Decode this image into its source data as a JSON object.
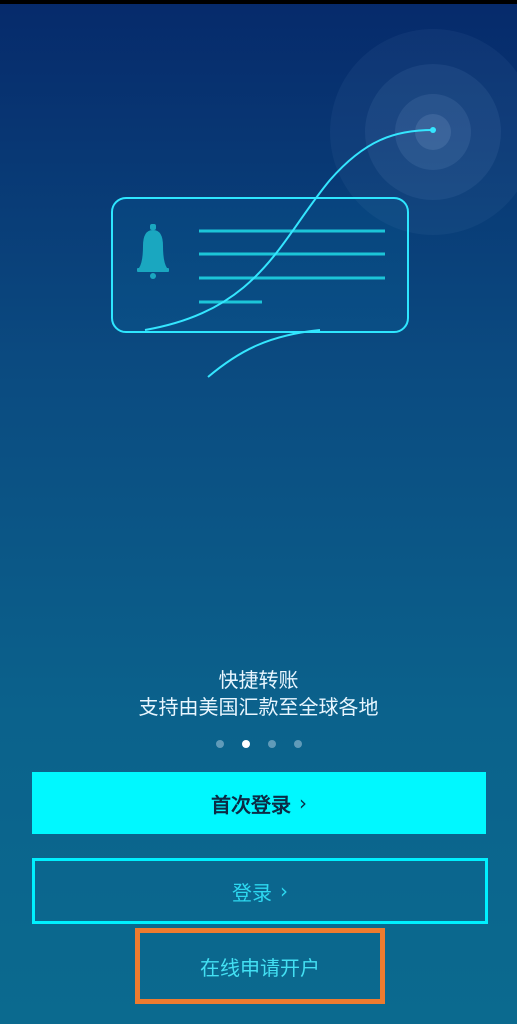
{
  "slide": {
    "title": "快捷转账",
    "subtitle": "支持由美国汇款至全球各地",
    "total": 4,
    "active_index": 1
  },
  "buttons": {
    "first_login": "首次登录",
    "first_login_chevron": "›",
    "login": "登录",
    "login_chevron": "›",
    "apply_online": "在线申请开户"
  },
  "colors": {
    "primary": "#00f8ff",
    "outline": "#00f0ff",
    "highlight_box": "#ee7b2f"
  },
  "icons": {
    "bell": "bell-icon"
  }
}
